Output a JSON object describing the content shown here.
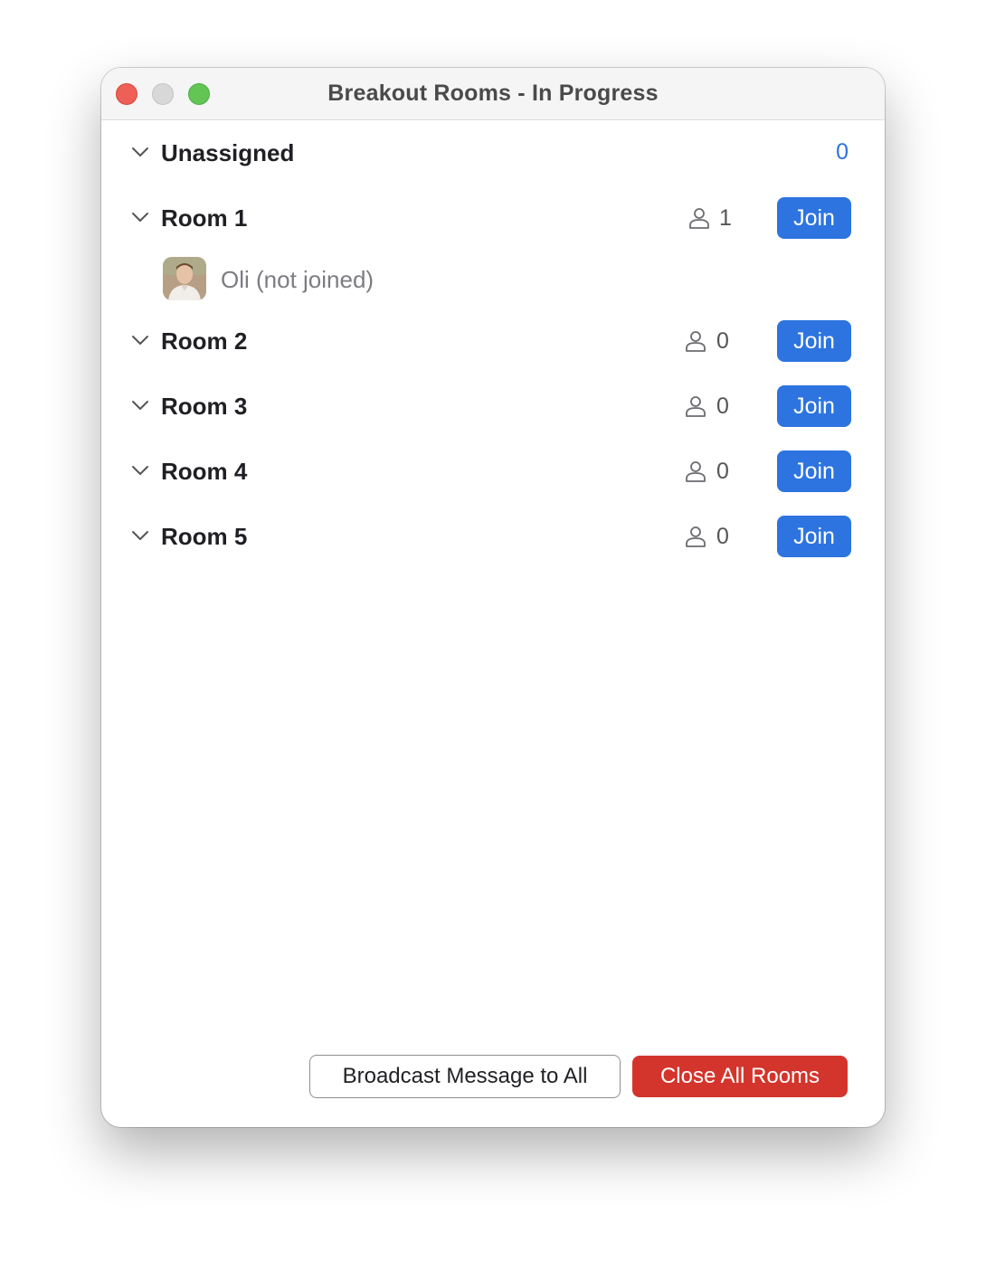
{
  "window": {
    "title": "Breakout Rooms - In Progress"
  },
  "unassigned": {
    "label": "Unassigned",
    "count": "0"
  },
  "rooms": [
    {
      "label": "Room 1",
      "count": "1",
      "join_label": "Join"
    },
    {
      "label": "Room 2",
      "count": "0",
      "join_label": "Join"
    },
    {
      "label": "Room 3",
      "count": "0",
      "join_label": "Join"
    },
    {
      "label": "Room 4",
      "count": "0",
      "join_label": "Join"
    },
    {
      "label": "Room 5",
      "count": "0",
      "join_label": "Join"
    }
  ],
  "participants": [
    {
      "name": "Oli (not joined)",
      "room": "Room 1"
    }
  ],
  "footer": {
    "broadcast_label": "Broadcast Message to All",
    "close_label": "Close All Rooms"
  },
  "colors": {
    "accent": "#2d74e0",
    "danger": "#d3352c",
    "count_blue": "#2b74df"
  },
  "icons": {
    "chevron": "chevron-down-icon",
    "person": "person-icon"
  }
}
